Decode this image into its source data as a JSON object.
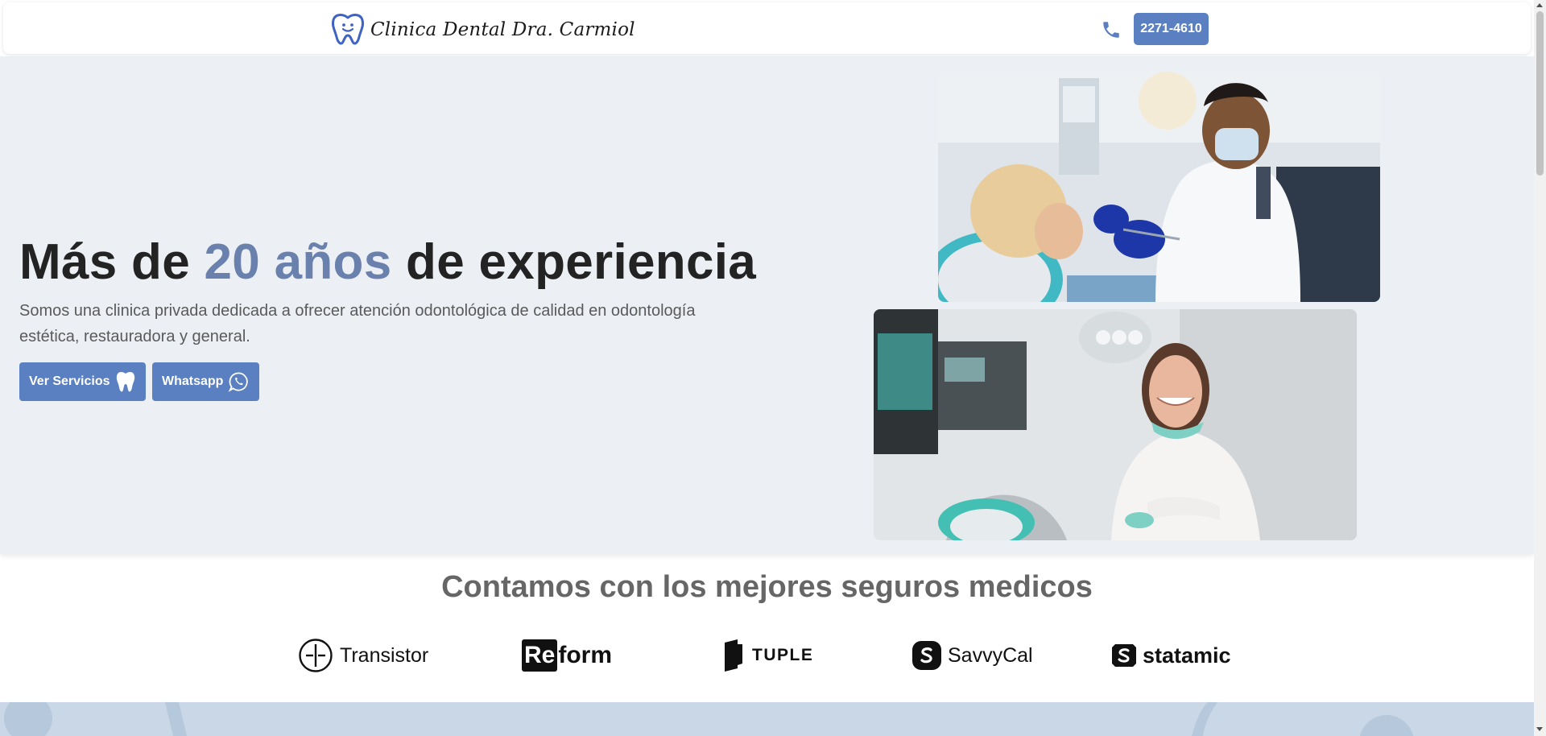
{
  "header": {
    "brand_name": "Clinica Dental Dra. Carmiol",
    "phone": "2271-4610"
  },
  "hero": {
    "title_start": "Más de ",
    "title_accent": "20 años",
    "title_end": " de experiencia",
    "description": "Somos una clinica privada dedicada a ofrecer atención odontológica de calidad en odontología estética, restauradora y general.",
    "services_button": "Ver Servicios",
    "whatsapp_button": "Whatsapp"
  },
  "insurers": {
    "title": "Contamos con los mejores seguros medicos",
    "logos": [
      {
        "name": "Transistor"
      },
      {
        "name_box": "Re",
        "name_rest": "form"
      },
      {
        "name": "TUPLE"
      },
      {
        "name": "SavvyCal"
      },
      {
        "name": "statamic"
      }
    ]
  },
  "colors": {
    "accent": "#5a80c1",
    "title_accent": "#6a80ad",
    "hero_bg": "#eceff4",
    "band_bg": "#c9d7e6"
  },
  "icons": {
    "brand": "tooth-smile-icon",
    "phone": "phone-icon",
    "services": "tooth-icon",
    "whatsapp": "whatsapp-icon"
  }
}
